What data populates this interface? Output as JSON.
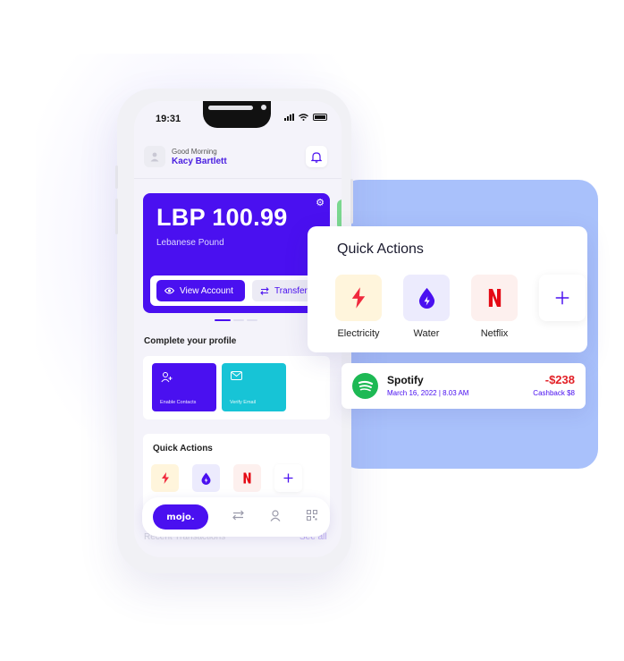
{
  "status_bar": {
    "time": "19:31"
  },
  "header": {
    "greeting": "Good Morning",
    "username": "Kacy Bartlett"
  },
  "balance_card": {
    "amount": "LBP 100.99",
    "currency": "Lebanese Pound",
    "view_account_label": "View Account",
    "transfer_label": "Transfer"
  },
  "profile": {
    "title": "Complete your profile",
    "tiles": [
      {
        "label": "Enable Contacts",
        "color": "#4a10f0",
        "icon": "add-user-icon"
      },
      {
        "label": "Verify Email",
        "color": "#17c4d6",
        "icon": "email-check-icon"
      }
    ]
  },
  "phone_quick_actions": {
    "title": "Quick Actions"
  },
  "bottom_nav": {
    "logo": "mojo.",
    "items": [
      "transfer-icon",
      "profile-icon",
      "qr-code-icon"
    ]
  },
  "recent": {
    "title": "Recent Transactions",
    "see_all": "See all"
  },
  "quick_actions_popup": {
    "title": "Quick Actions",
    "items": [
      {
        "label": "Electricity",
        "icon": "lightning-icon",
        "bg": "#fff5dc",
        "color": "#f0293d"
      },
      {
        "label": "Water",
        "icon": "water-drop-icon",
        "bg": "#ecebfd",
        "color": "#4a10f0"
      },
      {
        "label": "Netflix",
        "icon": "netflix-icon",
        "bg": "#fdf0ee",
        "color": "#e50914"
      },
      {
        "label": "",
        "icon": "plus-icon",
        "bg": "#ffffff",
        "color": "#4a10f0"
      }
    ]
  },
  "transaction": {
    "merchant": "Spotify",
    "date": "March 16, 2022 | 8.03 AM",
    "amount": "-$238",
    "cashback": "Cashback $8"
  },
  "colors": {
    "primary": "#4a10f0",
    "negative": "#e21f26",
    "panel": "#a9c1fb"
  }
}
